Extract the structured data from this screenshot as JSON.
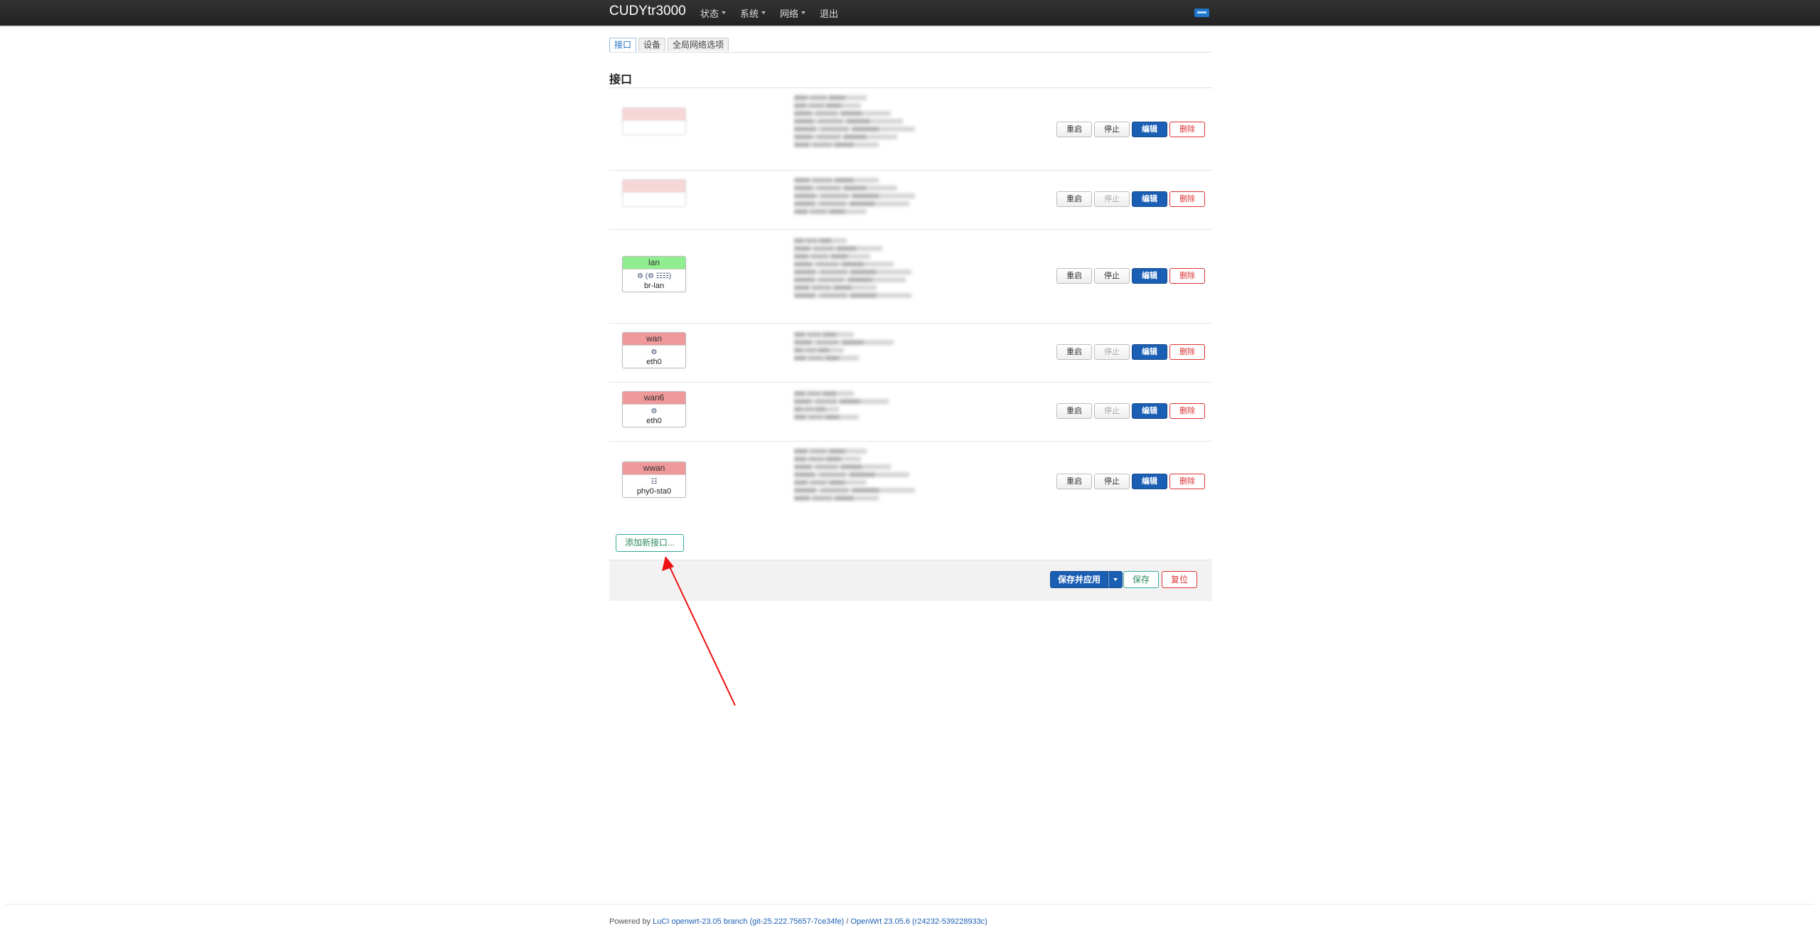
{
  "header": {
    "brand": "CUDYtr3000",
    "nav": [
      {
        "label": "状态",
        "has_caret": true
      },
      {
        "label": "系统",
        "has_caret": true
      },
      {
        "label": "网络",
        "has_caret": true
      },
      {
        "label": "退出",
        "has_caret": false
      }
    ]
  },
  "tabs": [
    {
      "label": "接口",
      "active": true
    },
    {
      "label": "设备",
      "active": false
    },
    {
      "label": "全局网络选项",
      "active": false
    }
  ],
  "section_title": "接口",
  "interfaces": [
    {
      "name": "",
      "device": "",
      "icons": "",
      "stop_disabled": false,
      "blurred": true
    },
    {
      "name": "",
      "device": "",
      "icons": "",
      "stop_disabled": true,
      "blurred": true
    },
    {
      "name": "lan",
      "device": "br-lan",
      "icons": "⚙ (⚙ ☷☷)",
      "stop_disabled": false,
      "blurred": false
    },
    {
      "name": "wan",
      "device": "eth0",
      "icons": "⚙",
      "stop_disabled": true,
      "blurred": false
    },
    {
      "name": "wan6",
      "device": "eth0",
      "icons": "⚙",
      "stop_disabled": true,
      "blurred": false
    },
    {
      "name": "wwan",
      "device": "phy0-sta0",
      "icons": "☷",
      "stop_disabled": false,
      "blurred": false
    }
  ],
  "row_buttons": {
    "restart": "重启",
    "stop": "停止",
    "edit": "编辑",
    "delete": "删除"
  },
  "add_interface_label": "添加新接口...",
  "footer_actions": {
    "save_apply": "保存并应用",
    "save": "保存",
    "reset": "复位"
  },
  "page_footer": {
    "powered_by": "Powered by",
    "luci_link": "LuCI openwrt-23.05 branch (git-25.222.75657-7ce34fe)",
    "separator": "/",
    "openwrt_link": "OpenWrt 23.05.6 (r24232-539228933c)"
  },
  "colors": {
    "topbar": "#222222",
    "primary": "#1a5fb4",
    "danger": "#dd3333",
    "positive": "#2a8a5f",
    "badge_up": "#90ee90",
    "badge_down": "#f0999b",
    "annotation_arrow": "#ee1111"
  }
}
